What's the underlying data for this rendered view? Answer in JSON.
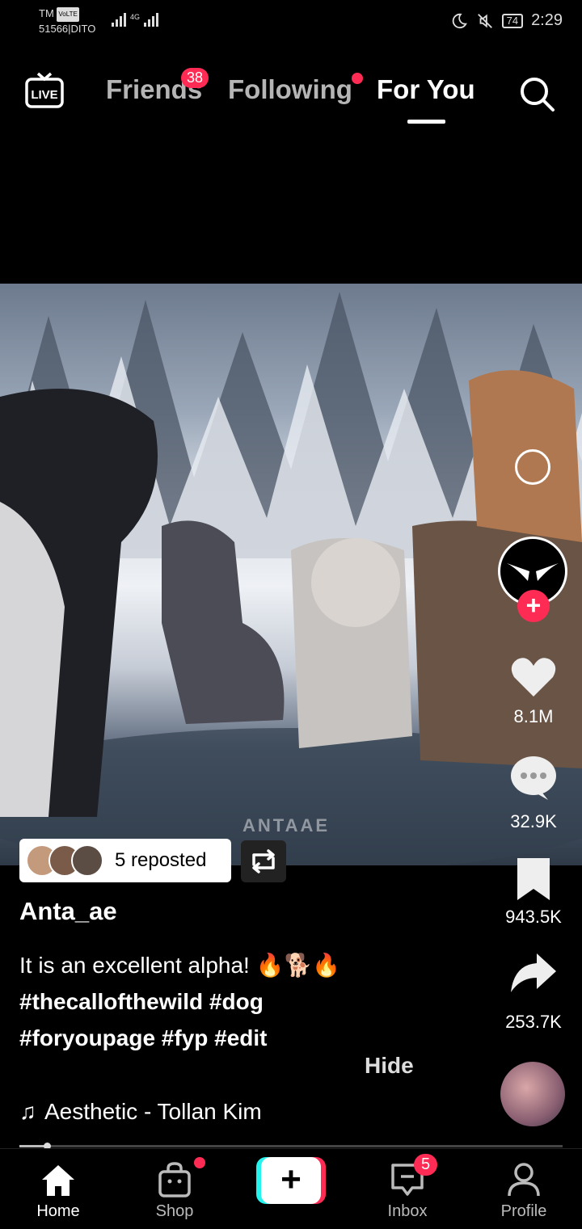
{
  "status_bar": {
    "carrier_line1": "TM",
    "volte": "VoLTE",
    "carrier_line2": "51566|DITO",
    "network": "4G",
    "battery": "74",
    "time": "2:29",
    "icons": [
      "moon-icon",
      "mute-icon",
      "battery-icon"
    ]
  },
  "top_nav": {
    "live_label": "LIVE",
    "tabs": [
      {
        "label": "Friends",
        "badge": "38"
      },
      {
        "label": "Following",
        "dot": true
      },
      {
        "label": "For You",
        "active": true
      }
    ],
    "search_icon": "search-icon"
  },
  "video": {
    "watermark": "ANTAAE"
  },
  "rail": {
    "likes": "8.1M",
    "comments": "32.9K",
    "bookmarks": "943.5K",
    "shares": "253.7K",
    "follow_symbol": "+"
  },
  "repost": {
    "text": "5 reposted"
  },
  "post": {
    "username": "Anta_ae",
    "caption_text": "It is an excellent alpha! 🔥🐕🔥",
    "hashtags_line1": "#thecallofthewild #dog",
    "hashtags_line2": "#foryoupage #fyp #edit",
    "hide_label": "Hide",
    "sound": "Aesthetic - Tollan Kim",
    "music_icon": "♫",
    "progress": 0.05
  },
  "bottom_nav": {
    "home": "Home",
    "shop": "Shop",
    "create_symbol": "+",
    "inbox": "Inbox",
    "inbox_badge": "5",
    "profile": "Profile"
  },
  "colors": {
    "accent": "#fe2c55",
    "cyan": "#25f4ee",
    "background": "#000000"
  }
}
